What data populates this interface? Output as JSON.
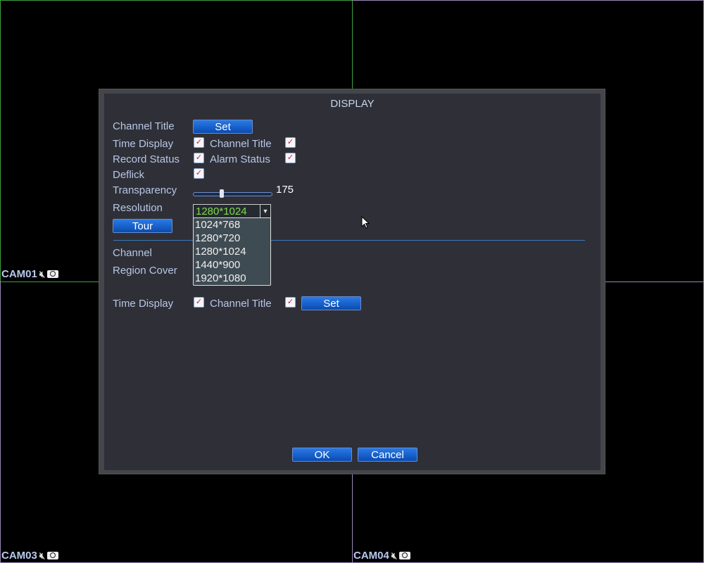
{
  "cameras": [
    {
      "label": "CAM01"
    },
    {
      "label": "CAM03"
    },
    {
      "label": "CAM04"
    }
  ],
  "dialog": {
    "title": "DISPLAY",
    "channel_title_label": "Channel Title",
    "set_label": "Set",
    "time_display": "Time Display",
    "channel_title": "Channel Title",
    "record_status": "Record Status",
    "alarm_status": "Alarm Status",
    "deflick": "Deflick",
    "transparency": "Transparency",
    "transparency_value": "175",
    "resolution": "Resolution",
    "resolution_value": "1280*1024",
    "resolution_options": [
      "1024*768",
      "1280*720",
      "1280*1024",
      "1440*900",
      "1920*1080"
    ],
    "tour": "Tour",
    "channel": "Channel",
    "region_cover": "Region Cover",
    "time_display2": "Time Display",
    "channel_title2": "Channel Title",
    "set2": "Set",
    "ok": "OK",
    "cancel": "Cancel",
    "checks": {
      "time_display": true,
      "channel_title": true,
      "record_status": true,
      "alarm_status": true,
      "deflick": true,
      "time_display2": true,
      "channel_title2": true
    },
    "transparency_fraction": 0.35
  }
}
